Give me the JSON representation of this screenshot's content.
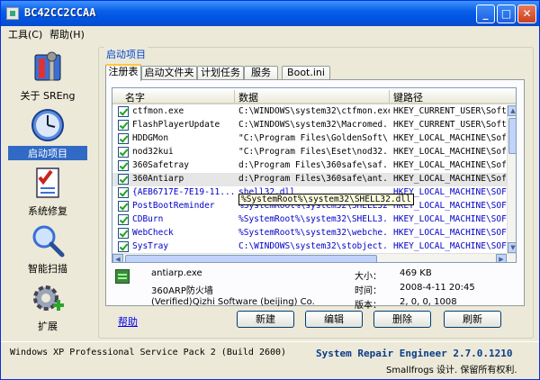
{
  "window": {
    "title": "BC42CC2CCAA",
    "minimize": "_",
    "maximize": "□",
    "close": "✕"
  },
  "menu": [
    "工具(C)",
    "帮助(H)"
  ],
  "nav": [
    {
      "label": "关于 SREng",
      "icon": "tools-icon"
    },
    {
      "label": "启动项目",
      "icon": "clock-icon",
      "selected": true
    },
    {
      "label": "系统修复",
      "icon": "checklist-icon"
    },
    {
      "label": "智能扫描",
      "icon": "magnifier-icon"
    },
    {
      "label": "扩展",
      "icon": "gear-plus-icon"
    }
  ],
  "group_label": "启动项目",
  "tabs": [
    "注册表",
    "启动文件夹",
    "计划任务",
    "服务",
    "Boot.ini"
  ],
  "active_tab": "注册表",
  "columns": [
    "名字",
    "数据",
    "键路径"
  ],
  "rows": [
    {
      "name": "ctfmon.exe",
      "data": "C:\\WINDOWS\\system32\\ctfmon.exe",
      "key": "HKEY_CURRENT_USER\\Soft"
    },
    {
      "name": "FlashPlayerUpdate",
      "data": "C:\\WINDOWS\\system32\\Macromed...",
      "key": "HKEY_CURRENT_USER\\Soft"
    },
    {
      "name": "HDDGMon",
      "data": "\"C:\\Program Files\\GoldenSoft\\...",
      "key": "HKEY_LOCAL_MACHINE\\Soft"
    },
    {
      "name": "nod32kui",
      "data": "\"C:\\Program Files\\Eset\\nod32...",
      "key": "HKEY_LOCAL_MACHINE\\Soft"
    },
    {
      "name": "360Safetray",
      "data": "d:\\Program Files\\360safe\\saf...",
      "key": "HKEY_LOCAL_MACHINE\\Soft"
    },
    {
      "name": "360Antiarp",
      "data": "d:\\Program Files\\360safe\\ant...",
      "key": "HKEY_LOCAL_MACHINE\\Soft",
      "selected": true
    },
    {
      "name": "{AEB6717E-7E19-11...",
      "data": "shell32.dll",
      "key": "HKEY_LOCAL_MACHINE\\SOFT",
      "blue": true
    },
    {
      "name": "PostBootReminder",
      "data": "%SystemRoot%\\system32\\SHELL32.dll",
      "key": "HKEY_LOCAL_MACHINE\\SOFT",
      "blue": true
    },
    {
      "name": "CDBurn",
      "data": "%SystemRoot%\\system32\\SHELL3...",
      "key": "HKEY_LOCAL_MACHINE\\SOFT",
      "blue": true
    },
    {
      "name": "WebCheck",
      "data": "%SystemRoot%\\system32\\webche...",
      "key": "HKEY_LOCAL_MACHINE\\SOFT",
      "blue": true
    },
    {
      "name": "SysTray",
      "data": "C:\\WINDOWS\\system32\\stobject...",
      "key": "HKEY_LOCAL_MACHINE\\SOFT",
      "blue": true
    }
  ],
  "tooltip": "%SystemRoot%\\system32\\SHELL32.dll",
  "details": {
    "file": "antiarp.exe",
    "desc": "360ARP防火墙",
    "company": "(Verified)Qizhi Software (beijing) Co.",
    "size_label": "大小：",
    "size_value": "469 KB",
    "time_label": "时间：",
    "time_value": "2008-4-11 20:45",
    "version_label": "版本：",
    "version_value": "2, 0, 0, 1008"
  },
  "help_link": "帮助",
  "buttons": [
    "新建",
    "编辑",
    "删除",
    "刷新"
  ],
  "status": {
    "os": "Windows XP Professional Service Pack 2 (Build 2600)",
    "product": "System Repair Engineer 2.7.0.1210",
    "copyright": "Smallfrogs 设计. 保留所有权利."
  }
}
